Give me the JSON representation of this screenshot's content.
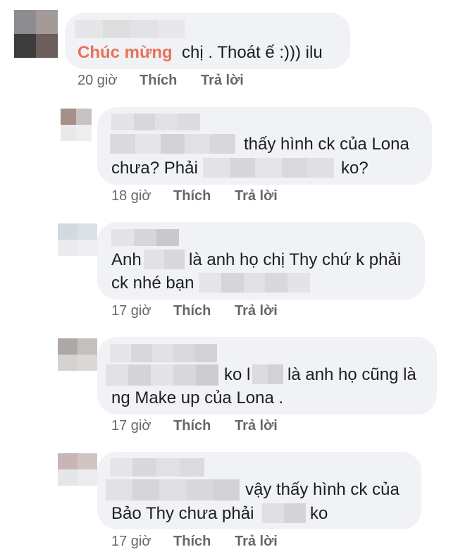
{
  "comments": [
    {
      "lines": [
        {
          "parts": [
            {
              "text": "Chúc mừng",
              "accent": true
            },
            {
              "text": "  chị . Thoát ế :))) ilu"
            }
          ]
        }
      ],
      "time": "20 giờ",
      "like_label": "Thích",
      "reply_label": "Trả lời"
    },
    {
      "line1_after": "thấy hình ck của Lona",
      "line2_before": "chưa? Phải",
      "line2_after": "ko?",
      "time": "18 giờ",
      "like_label": "Thích",
      "reply_label": "Trả lời"
    },
    {
      "line1_before": "Anh",
      "line1_after": "là anh họ chị Thy chứ k phải",
      "line2_before": "ck nhé bạn",
      "time": "17 giờ",
      "like_label": "Thích",
      "reply_label": "Trả lời"
    },
    {
      "line1_mid": "ko l",
      "line1_after": "là anh họ cũng là",
      "line2": "ng Make up của Lona .",
      "time": "17 giờ",
      "like_label": "Thích",
      "reply_label": "Trả lời"
    },
    {
      "line1_after": "vậy thấy hình ck của",
      "line2_before": "Bảo Thy chưa phải",
      "line2_after": "ko",
      "time": "17 giờ",
      "like_label": "Thích",
      "reply_label": "Trả lời"
    }
  ],
  "colors": {
    "bubble": "#f0f2f5",
    "meta": "#65676b",
    "accent": "#e9725a",
    "blur_light": "#e4e4e6",
    "blur_mid": "#d6d6d9"
  }
}
